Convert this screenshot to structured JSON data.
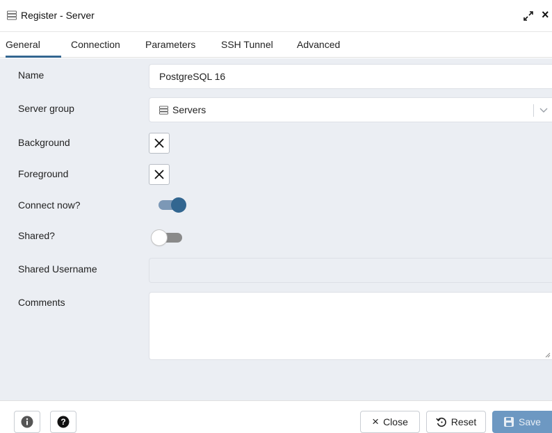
{
  "dialog": {
    "title": "Register - Server"
  },
  "tabs": [
    {
      "label": "General",
      "active": true
    },
    {
      "label": "Connection"
    },
    {
      "label": "Parameters"
    },
    {
      "label": "SSH Tunnel"
    },
    {
      "label": "Advanced"
    }
  ],
  "form": {
    "name": {
      "label": "Name",
      "value": "PostgreSQL 16"
    },
    "server_group": {
      "label": "Server group",
      "value": "Servers"
    },
    "background": {
      "label": "Background"
    },
    "foreground": {
      "label": "Foreground"
    },
    "connect_now": {
      "label": "Connect now?",
      "on": true
    },
    "shared": {
      "label": "Shared?",
      "on": false
    },
    "shared_username": {
      "label": "Shared Username",
      "value": ""
    },
    "comments": {
      "label": "Comments",
      "value": ""
    }
  },
  "footer": {
    "close_label": "Close",
    "reset_label": "Reset",
    "save_label": "Save"
  },
  "colors": {
    "accent": "#326690",
    "save_button": "#6d98c2",
    "content_bg": "#ebeef3"
  },
  "icons": [
    "server-group-icon",
    "expand-icon",
    "close-icon",
    "chevron-down-icon",
    "clear-x-icon",
    "info-icon",
    "help-icon",
    "reset-icon",
    "save-disk-icon"
  ]
}
